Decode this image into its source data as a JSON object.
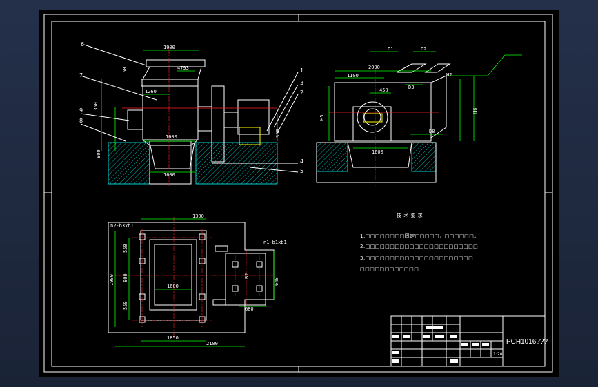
{
  "drawing_code": "PCH1016???",
  "front_view": {
    "part_labels": [
      "6",
      "7",
      "9",
      "8"
    ],
    "dims": [
      "1900",
      "4793",
      "1260",
      "1600",
      "1600",
      "1350",
      "800",
      "350",
      "150"
    ]
  },
  "side_view": {
    "part_labels": [
      "1",
      "3",
      "2",
      "4",
      "5"
    ],
    "dims": [
      "2000",
      "1100",
      "D1",
      "D2",
      "450",
      "D3",
      "H5",
      "H6",
      "D8",
      "1600",
      "H2"
    ]
  },
  "top_view": {
    "dims": [
      "1300",
      "1600",
      "1850",
      "2100",
      "550",
      "800",
      "1900",
      "550",
      "n2-b3xb1",
      "n1-b1xb1",
      "B2",
      "680",
      "640"
    ]
  },
  "tech_requirements": {
    "title": "技 术 要 求",
    "lines": [
      "1.□□□□□□□□固定□□□□□，□□□□□□。",
      "2.□□□□□□□□□□□□□□□□□□□□□□□",
      "3.□□□□□□□□□□□□□□□□□□□□□□",
      "□□□□□□□□□□□□"
    ]
  },
  "title_block": {
    "scale": "1:20"
  }
}
